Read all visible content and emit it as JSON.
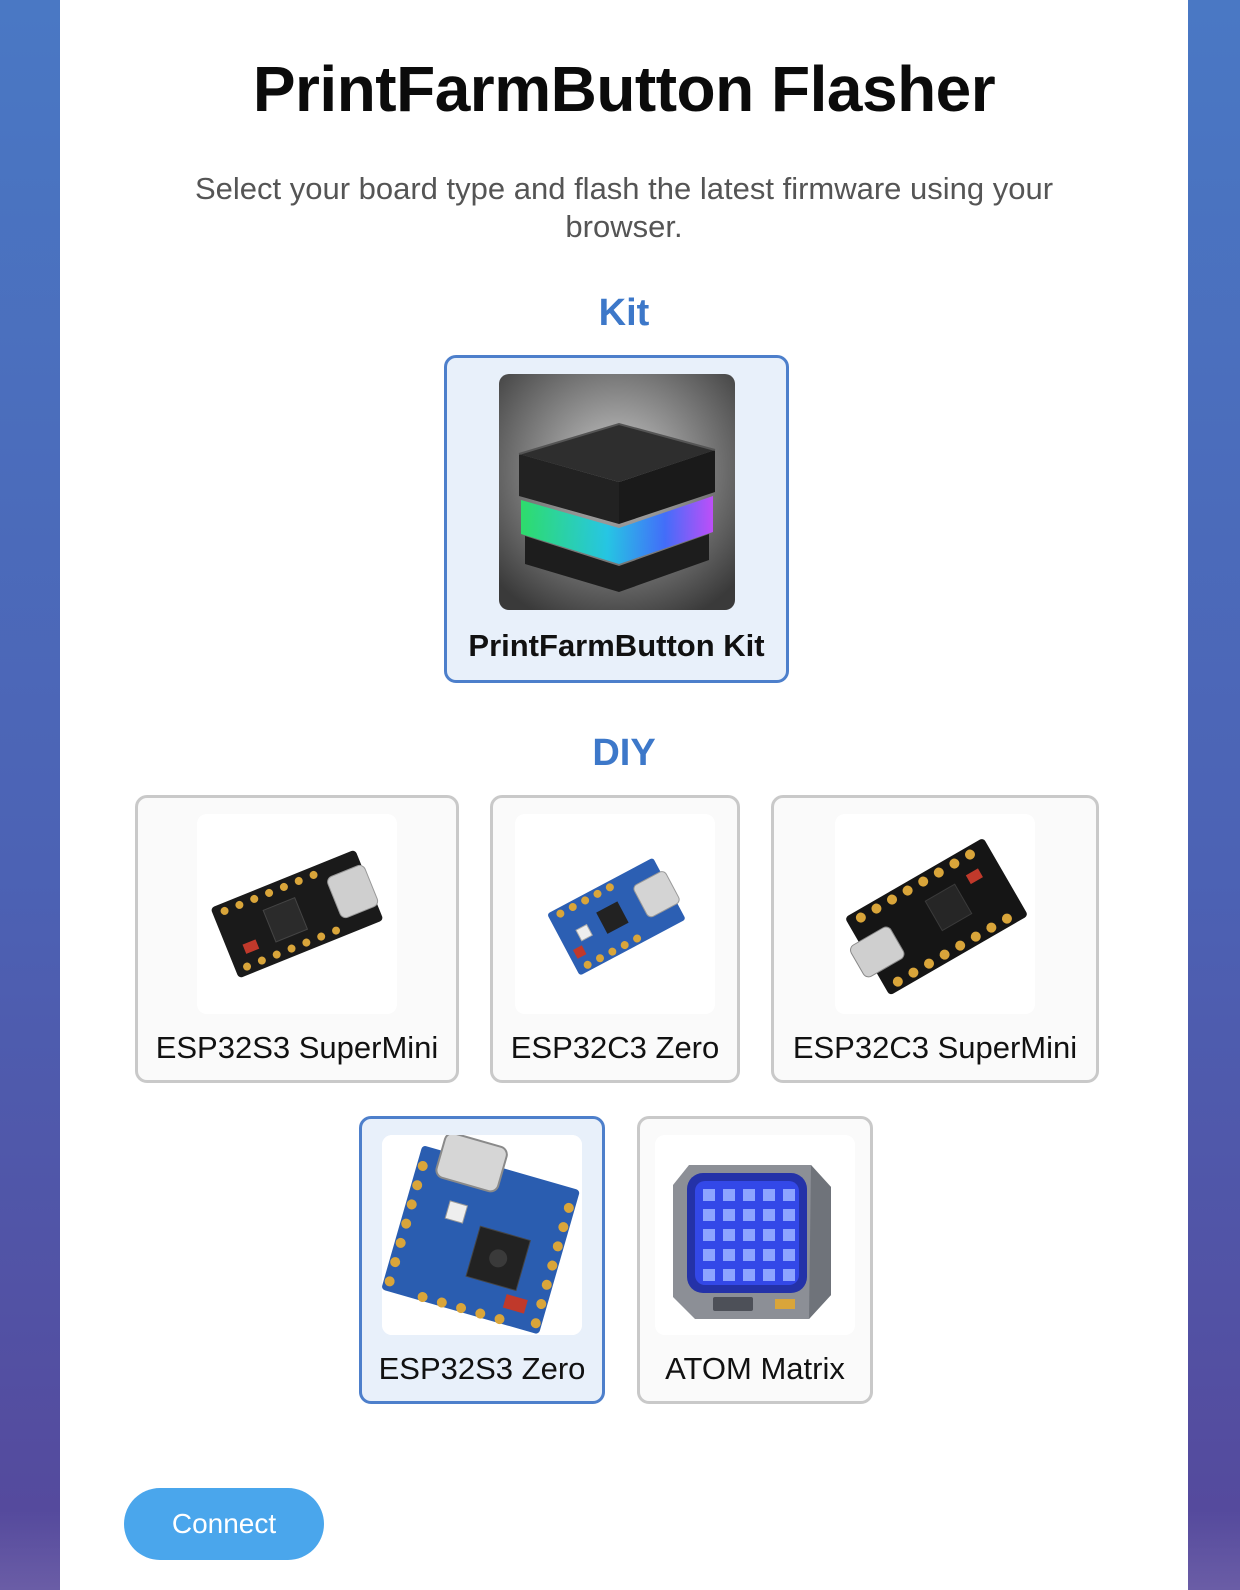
{
  "page": {
    "title": "PrintFarmButton Flasher",
    "subtitle": "Select your board type and flash the latest firmware using your browser."
  },
  "sections": {
    "kit": {
      "heading": "Kit",
      "boards": [
        {
          "name": "PrintFarmButton Kit",
          "selected": true,
          "icon": "printfarmbutton-kit-image"
        }
      ]
    },
    "diy": {
      "heading": "DIY",
      "boards": [
        {
          "name": "ESP32S3 SuperMini",
          "selected": false,
          "icon": "esp32s3-supermini-image"
        },
        {
          "name": "ESP32C3 Zero",
          "selected": false,
          "icon": "esp32c3-zero-image"
        },
        {
          "name": "ESP32C3 SuperMini",
          "selected": false,
          "icon": "esp32c3-supermini-image"
        },
        {
          "name": "ESP32S3 Zero",
          "selected": true,
          "icon": "esp32s3-zero-image"
        },
        {
          "name": "ATOM Matrix",
          "selected": false,
          "icon": "atom-matrix-image"
        }
      ]
    }
  },
  "actions": {
    "connect_label": "Connect"
  },
  "colors": {
    "accent": "#3d78c9",
    "selected_border": "#4d7fcb",
    "selected_background": "#e8f0fa",
    "connect_button": "#4aa6ec"
  }
}
